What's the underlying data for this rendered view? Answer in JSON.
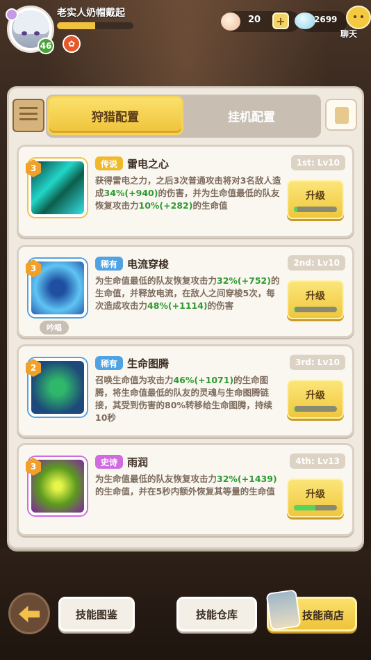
{
  "player": {
    "name": "老实人奶帽戴起",
    "level": "46",
    "exp_fraction": 0.5
  },
  "currency": {
    "shells": "20",
    "gems": "2699"
  },
  "chat_label": "聊天",
  "tabs": {
    "active": "狩猎配置",
    "inactive": "挂机配置"
  },
  "skills": [
    {
      "level": "3",
      "rarity": "传说",
      "rarity_color": "#f0b92b",
      "name": "雷电之心",
      "slot": "1st: Lv10",
      "desc": [
        {
          "t": "获得雷电之力，之后3次普通攻击将对3名敌人造成"
        },
        {
          "h": "34%(+940)"
        },
        {
          "t": "的伤害，并为生命值最低的队友恢复攻击力"
        },
        {
          "h": "10%(+282)"
        },
        {
          "t": "的生命值"
        }
      ],
      "upgrade": "升级",
      "progress": 0.08,
      "chant": ""
    },
    {
      "level": "3",
      "rarity": "稀有",
      "rarity_color": "#4fa3e3",
      "name": "电流穿梭",
      "slot": "2nd: Lv10",
      "desc": [
        {
          "t": "为生命值最低的队友恢复攻击力"
        },
        {
          "h": "32%(+752)"
        },
        {
          "t": "的生命值，并释放电流，在敌人之间穿梭5次，每次造成攻击力"
        },
        {
          "h": "48%(+1114)"
        },
        {
          "t": "的伤害"
        }
      ],
      "upgrade": "升级",
      "progress": 0.03,
      "chant": "吟唱"
    },
    {
      "level": "2",
      "rarity": "稀有",
      "rarity_color": "#4fa3e3",
      "name": "生命图腾",
      "slot": "3rd: Lv10",
      "desc": [
        {
          "t": "召唤生命值为攻击力"
        },
        {
          "h": "46%(+1071)"
        },
        {
          "t": "的生命图腾，将生命值最低的队友的灵魂与生命图腾链接，其受到伤害的80%转移给生命图腾，持续10秒"
        }
      ],
      "upgrade": "升级",
      "progress": 0.03,
      "chant": ""
    },
    {
      "level": "3",
      "rarity": "史诗",
      "rarity_color": "#d06be0",
      "name": "雨润",
      "slot": "4th: Lv13",
      "desc": [
        {
          "t": "为生命值最低的队友恢复攻击力"
        },
        {
          "h": "32%(+1439)"
        },
        {
          "t": "的生命值，并在5秒内额外恢复其等量的生命值"
        }
      ],
      "upgrade": "升级",
      "progress": 0.5,
      "chant": ""
    }
  ],
  "nav": {
    "codex": "技能图鉴",
    "storage": "技能仓库",
    "shop": "技能商店"
  }
}
